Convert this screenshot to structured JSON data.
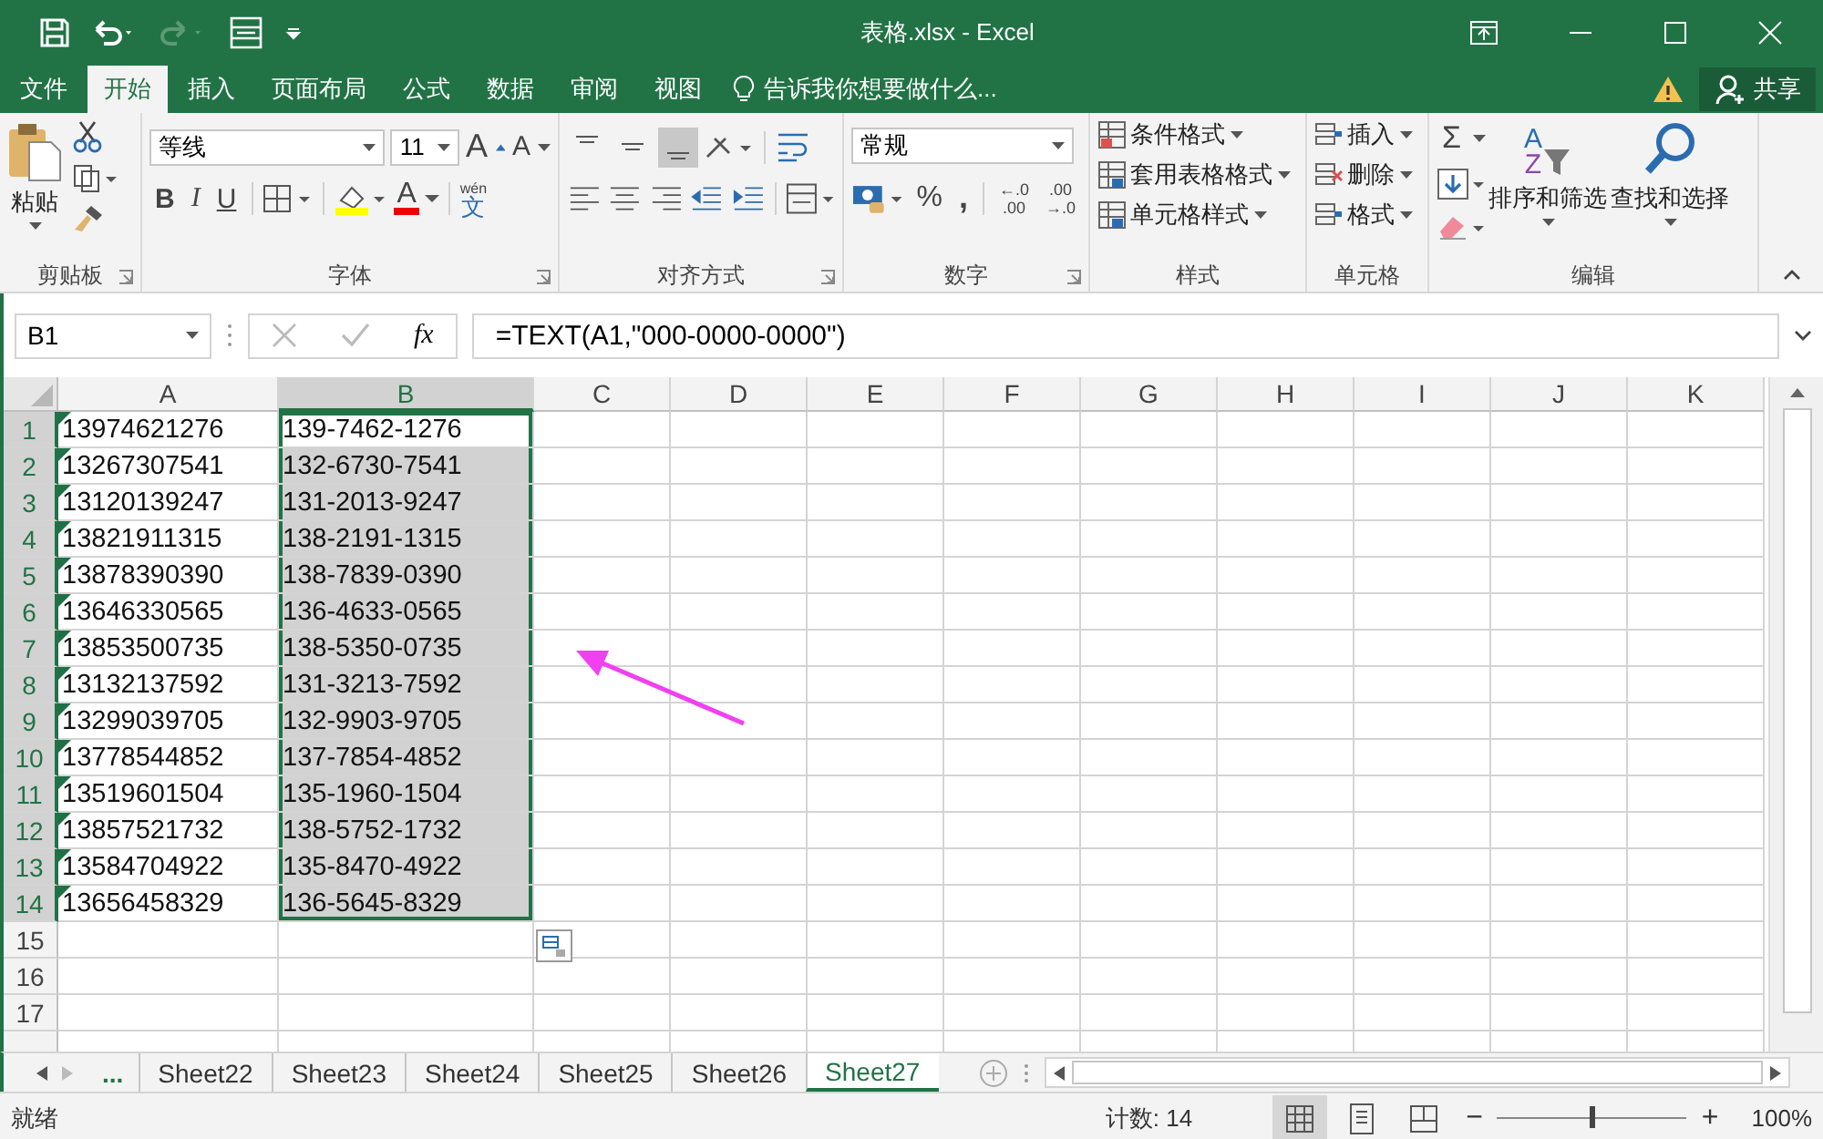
{
  "window": {
    "title": "表格.xlsx - Excel"
  },
  "ribbon_tabs": [
    {
      "label": "文件",
      "selected": false
    },
    {
      "label": "开始",
      "selected": true
    },
    {
      "label": "插入",
      "selected": false
    },
    {
      "label": "页面布局",
      "selected": false
    },
    {
      "label": "公式",
      "selected": false
    },
    {
      "label": "数据",
      "selected": false
    },
    {
      "label": "审阅",
      "selected": false
    },
    {
      "label": "视图",
      "selected": false
    }
  ],
  "tell_me": "告诉我你想要做什么...",
  "share": "共享",
  "ribbon": {
    "clipboard": {
      "paste": "粘贴",
      "label": "剪贴板"
    },
    "font": {
      "font_name": "等线",
      "font_size": "11",
      "grow": "A",
      "shrink": "A",
      "bold": "B",
      "italic": "I",
      "underline": "U",
      "font_color": "A",
      "phonetic_pinyin": "wén",
      "phonetic_char": "文",
      "label": "字体"
    },
    "alignment": {
      "vertical_align_buttons": [
        {
          "selected": false
        },
        {
          "selected": false
        },
        {
          "selected": true
        }
      ],
      "label": "对齐方式"
    },
    "number": {
      "format": "常规",
      "percent": "%",
      "comma": ",",
      "increase_decimal": [
        "←.0",
        ".00"
      ],
      "decrease_decimal": [
        ".00",
        "→.0"
      ],
      "label": "数字"
    },
    "styles": {
      "items": [
        "条件格式",
        "套用表格格式",
        "单元格样式"
      ],
      "label": "样式"
    },
    "cells": {
      "items": [
        "插入",
        "删除",
        "格式"
      ],
      "label": "单元格"
    },
    "editing": {
      "sum": "Σ",
      "sort_letters": [
        "A",
        "Z"
      ],
      "sort_filter": "排序和筛选",
      "find_select": "查找和选择",
      "label": "编辑"
    }
  },
  "formula_bar": {
    "name_box": "B1",
    "fx": "fx",
    "formula": "=TEXT(A1,\"000-0000-0000\")"
  },
  "sheet": {
    "columns": [
      {
        "label": "A",
        "selected": false
      },
      {
        "label": "B",
        "selected": true
      },
      {
        "label": "C",
        "selected": false
      },
      {
        "label": "D",
        "selected": false
      },
      {
        "label": "E",
        "selected": false
      },
      {
        "label": "F",
        "selected": false
      },
      {
        "label": "G",
        "selected": false
      },
      {
        "label": "H",
        "selected": false
      },
      {
        "label": "I",
        "selected": false
      },
      {
        "label": "J",
        "selected": false
      },
      {
        "label": "K",
        "selected": false
      }
    ],
    "rows": [
      {
        "number": "1",
        "selected": true,
        "flagged": true,
        "cells": [
          "13974621276",
          "139-7462-1276"
        ]
      },
      {
        "number": "2",
        "selected": true,
        "flagged": true,
        "cells": [
          "13267307541",
          "132-6730-7541"
        ]
      },
      {
        "number": "3",
        "selected": true,
        "flagged": true,
        "cells": [
          "13120139247",
          "131-2013-9247"
        ]
      },
      {
        "number": "4",
        "selected": true,
        "flagged": true,
        "cells": [
          "13821911315",
          "138-2191-1315"
        ]
      },
      {
        "number": "5",
        "selected": true,
        "flagged": true,
        "cells": [
          "13878390390",
          "138-7839-0390"
        ]
      },
      {
        "number": "6",
        "selected": true,
        "flagged": true,
        "cells": [
          "13646330565",
          "136-4633-0565"
        ]
      },
      {
        "number": "7",
        "selected": true,
        "flagged": true,
        "cells": [
          "13853500735",
          "138-5350-0735"
        ]
      },
      {
        "number": "8",
        "selected": true,
        "flagged": true,
        "cells": [
          "13132137592",
          "131-3213-7592"
        ]
      },
      {
        "number": "9",
        "selected": true,
        "flagged": true,
        "cells": [
          "13299039705",
          "132-9903-9705"
        ]
      },
      {
        "number": "10",
        "selected": true,
        "flagged": true,
        "cells": [
          "13778544852",
          "137-7854-4852"
        ]
      },
      {
        "number": "11",
        "selected": true,
        "flagged": true,
        "cells": [
          "13519601504",
          "135-1960-1504"
        ]
      },
      {
        "number": "12",
        "selected": true,
        "flagged": true,
        "cells": [
          "13857521732",
          "138-5752-1732"
        ]
      },
      {
        "number": "13",
        "selected": true,
        "flagged": true,
        "cells": [
          "13584704922",
          "135-8470-4922"
        ]
      },
      {
        "number": "14",
        "selected": true,
        "flagged": true,
        "cells": [
          "13656458329",
          "136-5645-8329"
        ]
      },
      {
        "number": "15",
        "selected": false,
        "flagged": false
      },
      {
        "number": "16",
        "selected": false,
        "flagged": false
      },
      {
        "number": "17",
        "selected": false,
        "flagged": false
      }
    ]
  },
  "sheet_tabs": {
    "more": "...",
    "tabs": [
      {
        "label": "Sheet22",
        "selected": false
      },
      {
        "label": "Sheet23",
        "selected": false
      },
      {
        "label": "Sheet24",
        "selected": false
      },
      {
        "label": "Sheet25",
        "selected": false
      },
      {
        "label": "Sheet26",
        "selected": false
      },
      {
        "label": "Sheet27",
        "selected": true
      }
    ]
  },
  "status_bar": {
    "ready": "就绪",
    "count": "计数: 14",
    "view_buttons": [
      {
        "selected": true
      },
      {
        "selected": false
      },
      {
        "selected": false
      }
    ],
    "zoom_out": "−",
    "zoom_slider": {
      "level": 0.5
    },
    "zoom_in": "+",
    "zoom": "100%"
  }
}
